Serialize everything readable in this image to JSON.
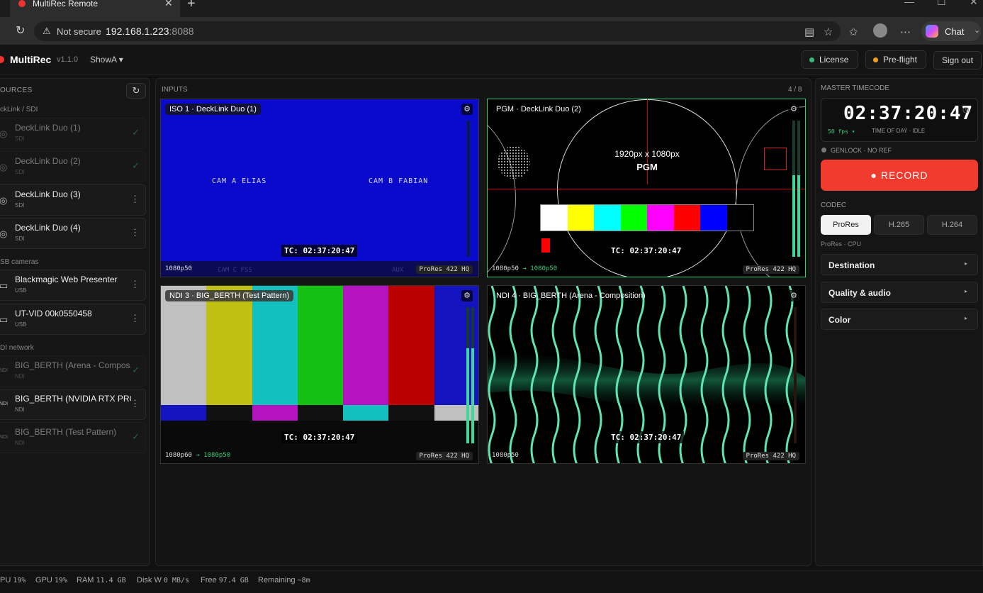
{
  "browser": {
    "tab_title": "MultiRec Remote",
    "not_secure": "Not secure",
    "url_host": "192.168.1.223",
    "url_port": ":8088",
    "copilot_label": "Chat"
  },
  "app": {
    "name": "MultiRec",
    "version": "v1.1.0",
    "show": "ShowA ▾",
    "license_label": "License",
    "preflight_label": "Pre-flight",
    "signout_label": "Sign out",
    "colors": {
      "accent_red": "#f23b2f",
      "ok_green": "#33bb77",
      "warn_amber": "#f2a01e"
    }
  },
  "sources": {
    "title": "OURCES",
    "groups": [
      {
        "label": "ckLink / SDI",
        "items": [
          {
            "name": "DeckLink Duo (1)",
            "type": "SDI",
            "status": "✓"
          },
          {
            "name": "DeckLink Duo (2)",
            "type": "SDI",
            "status": "✓"
          },
          {
            "name": "DeckLink Duo (3)",
            "type": "SDI",
            "status": "⋮"
          },
          {
            "name": "DeckLink Duo (4)",
            "type": "SDI",
            "status": "⋮"
          }
        ]
      },
      {
        "label": "SB cameras",
        "items": [
          {
            "name": "Blackmagic Web Presenter",
            "type": "USB",
            "status": "⋮"
          },
          {
            "name": "UT-VID 00k0550458",
            "type": "USB",
            "status": "⋮"
          }
        ]
      },
      {
        "label": "DI network",
        "items": [
          {
            "name": "BIG_BERTH (Arena - Compos...",
            "type": "NDI",
            "status": "✓"
          },
          {
            "name": "BIG_BERTH (NVIDIA RTX PRO ...",
            "type": "NDI",
            "status": "⋮"
          },
          {
            "name": "BIG_BERTH (Test Pattern)",
            "type": "NDI",
            "status": "✓"
          }
        ]
      }
    ]
  },
  "inputs": {
    "title": "INPUTS",
    "count": "4 / 8",
    "tiles": [
      {
        "label": "ISO 1 · DeckLink Duo (1)",
        "res": "1080p50",
        "res_out": "",
        "codec": "ProRes 422 HQ",
        "tc": "TC: 02:37:20:47",
        "cam_a": "CAM A ELIAS",
        "cam_b": "CAM B FABIAN",
        "cam_c": "CAM C FSS",
        "aux": "AUX",
        "meter": 0
      },
      {
        "label": "PGM · DeckLink Duo (2)",
        "res": "1080p50",
        "res_out": "1080p50",
        "codec": "ProRes 422 HQ",
        "tc": "TC: 02:37:20:47",
        "dims": "1920px x 1080px",
        "pgm": "PGM",
        "meter": 0.6
      },
      {
        "label": "NDI 3 · BIG_BERTH (Test Pattern)",
        "res": "1080p60",
        "res_out": "1080p50",
        "codec": "ProRes 422 HQ",
        "tc": "TC: 02:37:20:47",
        "meter": 0.7
      },
      {
        "label": "NDI 4 · BIG_BERTH (Arena - Composition)",
        "res": "1080p50",
        "res_out": "",
        "codec": "ProRes 422 HQ",
        "tc": "TC: 02:37:20:47",
        "meter": 0
      }
    ]
  },
  "right": {
    "mtc_title": "MASTER TIMECODE",
    "tc": "02:37:20:47",
    "fps": "50 fps ▾",
    "mode": "TIME OF DAY · IDLE",
    "genlock": "GENLOCK · NO REF",
    "record": "● RECORD",
    "codec_title": "CODEC",
    "codecs": [
      "ProRes",
      "H.265",
      "H.264"
    ],
    "codec_sub": "ProRes · CPU",
    "sections": [
      "Destination",
      "Quality & audio",
      "Color"
    ]
  },
  "status": {
    "cpu_label": "PU",
    "cpu": "19%",
    "gpu_label": "GPU",
    "gpu": "19%",
    "ram_label": "RAM",
    "ram": "11.4 GB",
    "disk_label": "Disk W",
    "disk": "0 MB/s",
    "free_label": "Free",
    "free": "97.4 GB",
    "remaining_label": "Remaining",
    "remaining": "~8m"
  }
}
